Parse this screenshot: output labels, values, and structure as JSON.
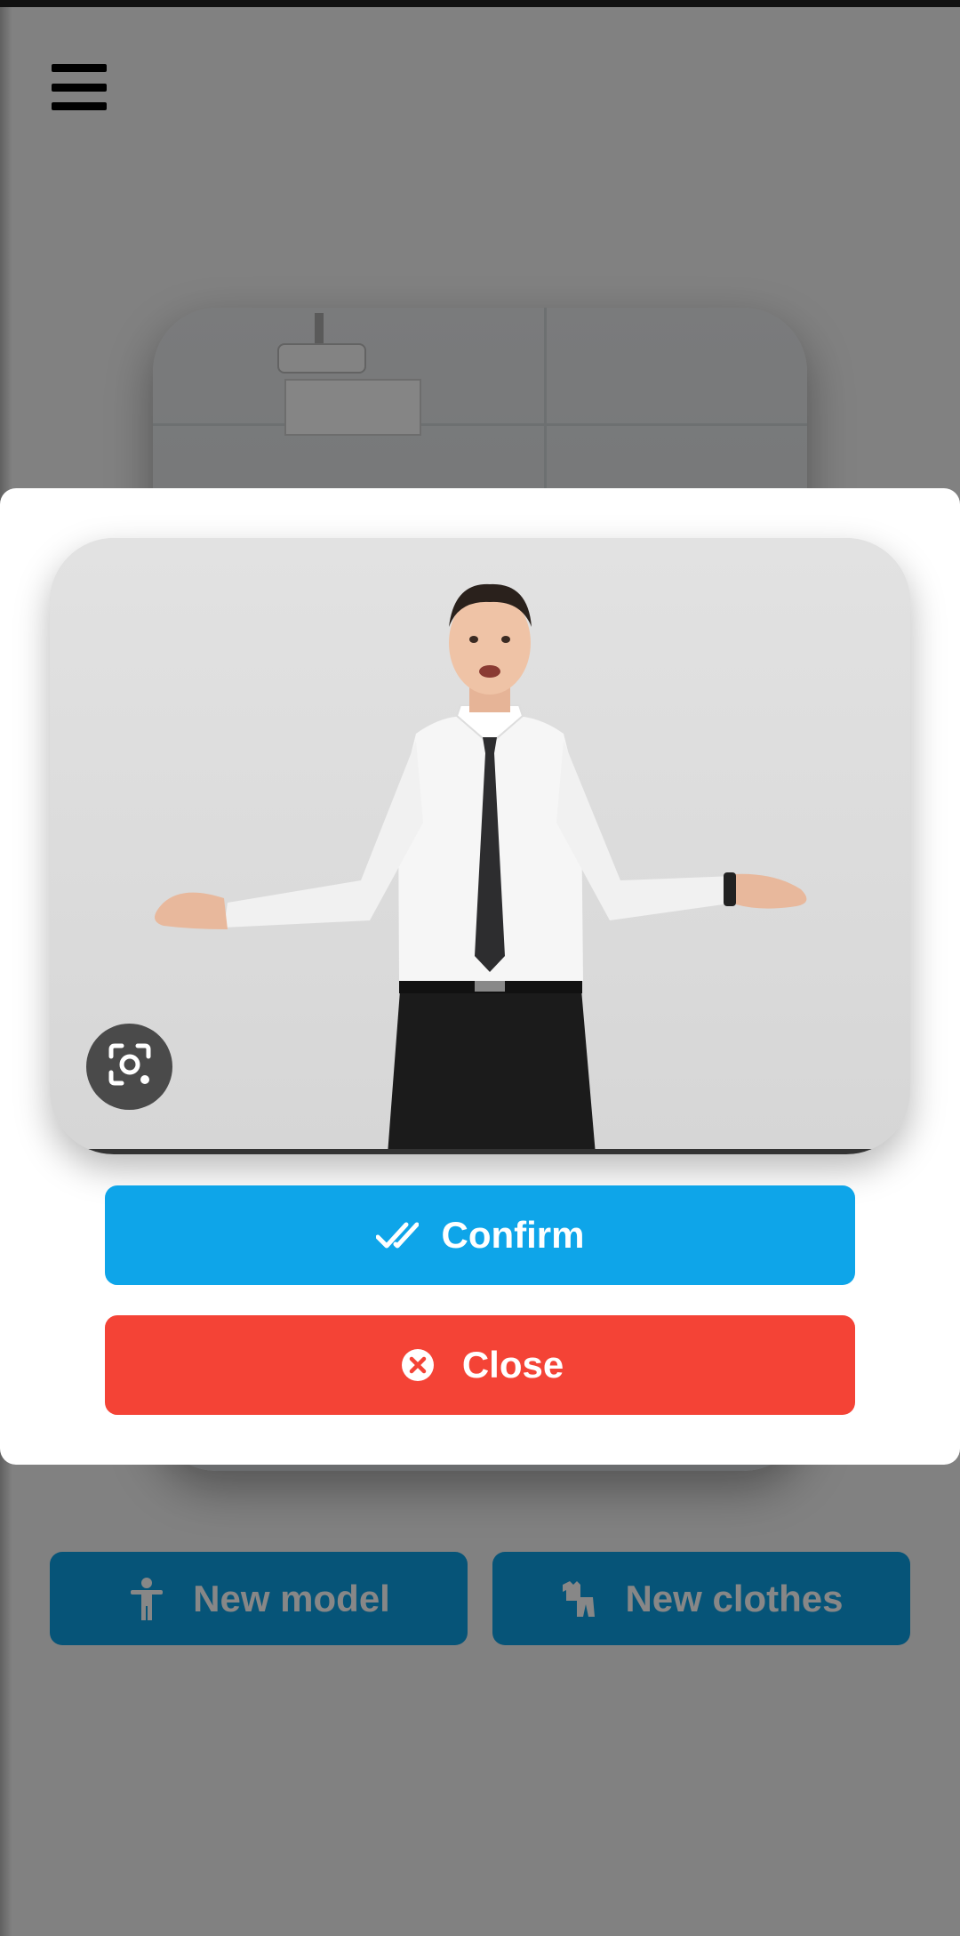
{
  "toolbar": {
    "menu_icon": "hamburger-menu-icon"
  },
  "main": {
    "actions": [
      {
        "label": "New model",
        "icon": "accessibility-person-icon"
      },
      {
        "label": "New clothes",
        "icon": "clothes-icon"
      }
    ]
  },
  "dialog": {
    "photo_icon": "google-lens-icon",
    "confirm_label": "Confirm",
    "confirm_icon": "double-check-icon",
    "close_label": "Close",
    "close_icon": "close-circle-icon"
  },
  "colors": {
    "primary": "#0ea5e9",
    "danger": "#f44336",
    "scrim": "rgba(0,0,0,0.47)"
  }
}
